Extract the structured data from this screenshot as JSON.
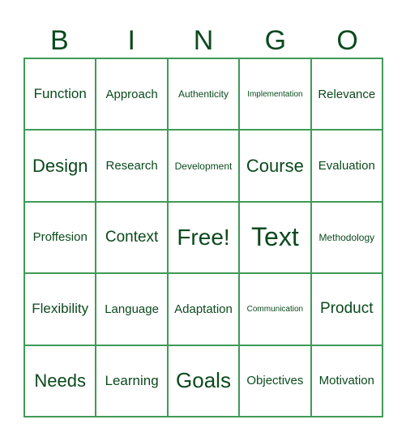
{
  "header": {
    "letters": [
      "B",
      "I",
      "N",
      "G",
      "O"
    ]
  },
  "colors": {
    "grid_border": "#3e9b57",
    "text": "#0b4a1d",
    "background": "#ffffff"
  },
  "board": {
    "rows": [
      [
        "Function",
        "Approach",
        "Authenticity",
        "Implementation",
        "Relevance"
      ],
      [
        "Design",
        "Research",
        "Development",
        "Course",
        "Evaluation"
      ],
      [
        "Proffesion",
        "Context",
        "Free!",
        "Text",
        "Methodology"
      ],
      [
        "Flexibility",
        "Language",
        "Adaptation",
        "Communication",
        "Product"
      ],
      [
        "Needs",
        "Learning",
        "Goals",
        "Objectives",
        "Motivation"
      ]
    ]
  }
}
